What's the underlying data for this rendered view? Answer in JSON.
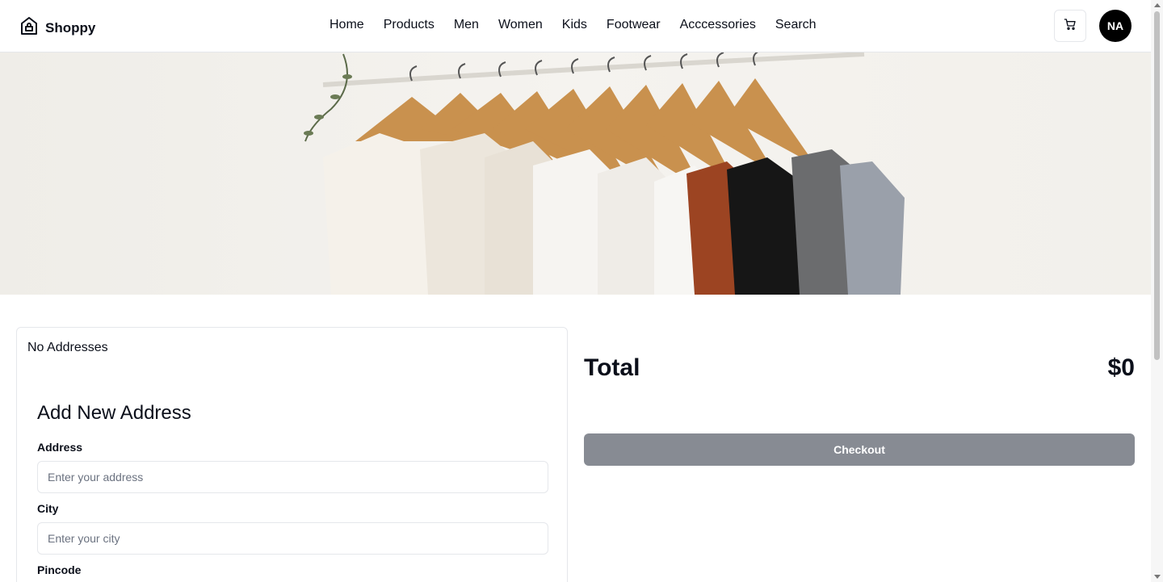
{
  "brand": {
    "name": "Shoppy",
    "icon": "shop-home-icon"
  },
  "nav": {
    "items": [
      {
        "label": "Home"
      },
      {
        "label": "Products"
      },
      {
        "label": "Men"
      },
      {
        "label": "Women"
      },
      {
        "label": "Kids"
      },
      {
        "label": "Footwear"
      },
      {
        "label": "Acccessories"
      },
      {
        "label": "Search"
      }
    ]
  },
  "header": {
    "cart_icon": "cart-icon",
    "avatar_initials": "NA"
  },
  "address": {
    "empty_text": "No Addresses",
    "form_title": "Add New Address",
    "address_label": "Address",
    "address_placeholder": "Enter your address",
    "address_value": "",
    "city_label": "City",
    "city_placeholder": "Enter your city",
    "city_value": "",
    "pincode_label": "Pincode"
  },
  "summary": {
    "total_label": "Total",
    "total_value": "$0",
    "checkout_label": "Checkout"
  },
  "colors": {
    "checkout_bg": "#878b93",
    "text": "#0b0f1a",
    "avatar_bg": "#000000"
  }
}
